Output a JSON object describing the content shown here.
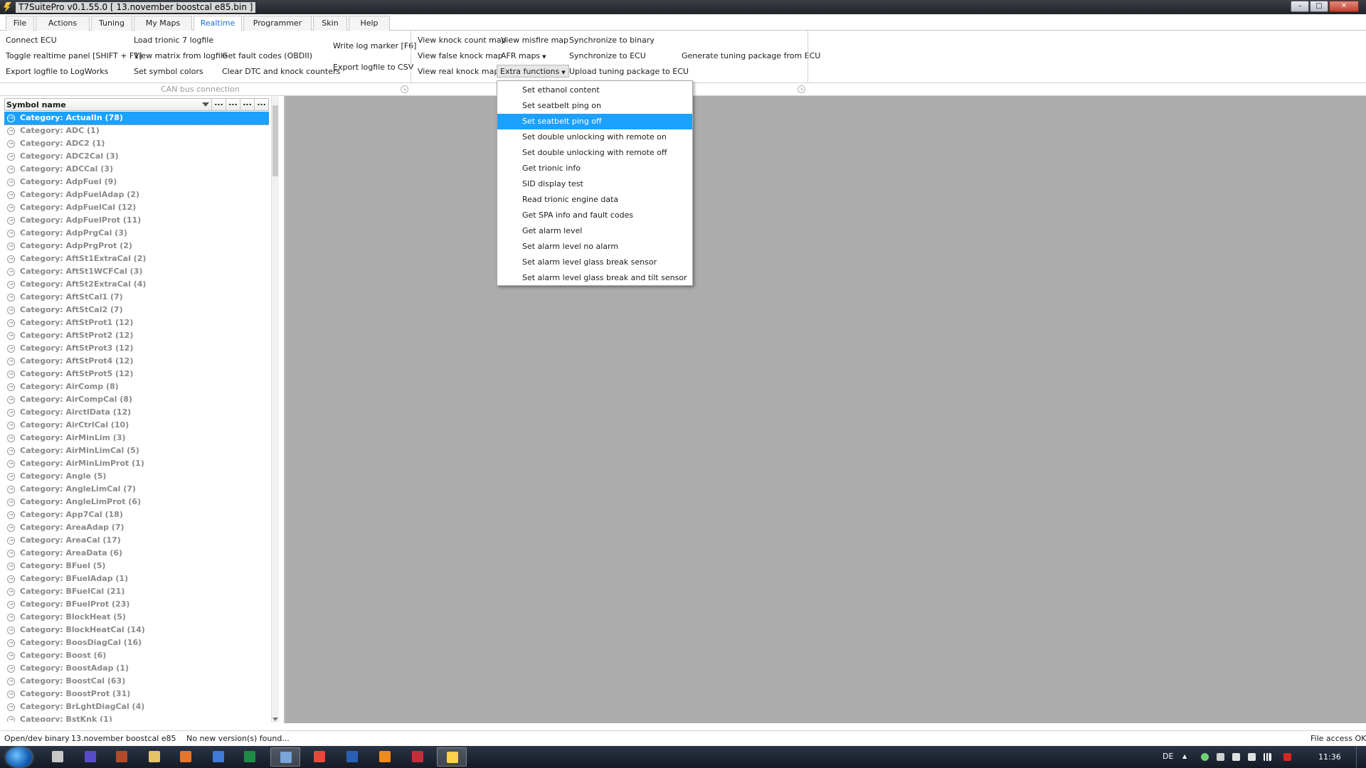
{
  "window": {
    "title": "T7SuitePro v0.1.55.0 [ 13.november boostcal e85.bin ]"
  },
  "menu": {
    "tabs": [
      {
        "label": "File"
      },
      {
        "label": "Actions"
      },
      {
        "label": "Tuning"
      },
      {
        "label": "My Maps"
      },
      {
        "label": "Realtime",
        "active": true
      },
      {
        "label": "Programmer"
      },
      {
        "label": "Skin"
      },
      {
        "label": "Help"
      }
    ]
  },
  "ribbon": {
    "can_bus": {
      "connect_ecu": "Connect ECU",
      "toggle_realtime_panel": "Toggle realtime panel [SHIFT + F1]",
      "export_logfile_logworks": "Export logfile to LogWorks",
      "load_trionic7_logfile": "Load trionic 7 logfile",
      "view_matrix_from_logfile": "View matrix from logfile",
      "set_symbol_colors": "Set symbol colors",
      "get_fault_codes": "Get fault codes (OBDII)",
      "clear_dtc": "Clear DTC and knock counters",
      "write_log_marker": "Write log marker [F6]",
      "export_logfile_csv": "Export logfile to CSV",
      "group_label": "CAN bus connection"
    },
    "maps": {
      "view_knock_count_map": "View knock count map",
      "view_false_knock_map": "View false knock map",
      "view_real_knock_map": "View real knock map",
      "view_misfire_map": "View misfire map",
      "afr_maps": "AFR maps",
      "extra_functions": "Extra functions",
      "synchronize_to_binary": "Synchronize to binary",
      "synchronize_to_ecu": "Synchronize to ECU",
      "upload_tuning_package": "Upload tuning package to ECU",
      "generate_tuning_package": "Generate tuning package from ECU"
    }
  },
  "symbol_panel": {
    "header": "Symbol name",
    "header_buttons": [
      "...",
      "...",
      "...",
      "..."
    ],
    "rows": [
      "Category: ActualIn (78)",
      "Category: ADC (1)",
      "Category: ADC2 (1)",
      "Category: ADC2Cal (3)",
      "Category: ADCCal (3)",
      "Category: AdpFuel (9)",
      "Category: AdpFuelAdap (2)",
      "Category: AdpFuelCal (12)",
      "Category: AdpFuelProt (11)",
      "Category: AdpPrgCal (3)",
      "Category: AdpPrgProt (2)",
      "Category: AftSt1ExtraCal (2)",
      "Category: AftSt1WCFCal (3)",
      "Category: AftSt2ExtraCal (4)",
      "Category: AftStCal1 (7)",
      "Category: AftStCal2 (7)",
      "Category: AftStProt1 (12)",
      "Category: AftStProt2 (12)",
      "Category: AftStProt3 (12)",
      "Category: AftStProt4 (12)",
      "Category: AftStProt5 (12)",
      "Category: AirComp (8)",
      "Category: AirCompCal (8)",
      "Category: AirctlData (12)",
      "Category: AirCtrlCal (10)",
      "Category: AirMinLim (3)",
      "Category: AirMinLimCal (5)",
      "Category: AirMinLimProt (1)",
      "Category: Angle (5)",
      "Category: AngleLimCal (7)",
      "Category: AngleLimProt (6)",
      "Category: App7Cal (18)",
      "Category: AreaAdap (7)",
      "Category: AreaCal (17)",
      "Category: AreaData (6)",
      "Category: BFuel (5)",
      "Category: BFuelAdap (1)",
      "Category: BFuelCal (21)",
      "Category: BFuelProt (23)",
      "Category: BlockHeat (5)",
      "Category: BlockHeatCal (14)",
      "Category: BoosDiagCal (16)",
      "Category: Boost (6)",
      "Category: BoostAdap (1)",
      "Category: BoostCal (63)",
      "Category: BoostProt (31)",
      "Category: BrLghtDiagCal (4)",
      "Category: BstKnk (1)"
    ],
    "selected_index": 0
  },
  "extra_functions_menu": {
    "items": [
      "Set ethanol content",
      "Set seatbelt ping on",
      "Set seatbelt ping off",
      "Set double unlocking with remote on",
      "Set double unlocking with remote off",
      "Get trionic info",
      "SID display test",
      "Read trionic engine data",
      "Get SPA info and fault codes",
      "Get alarm level",
      "Set alarm level no alarm",
      "Set alarm level glass break sensor",
      "Set alarm level glass break and tilt sensor"
    ],
    "highlighted_index": 2
  },
  "status_bar": {
    "mode": "Open/dev binary",
    "filename": "13.november boostcal e85",
    "version_msg": "No new version(s) found...",
    "file_access": "File access OK"
  },
  "taskbar": {
    "language": "DE",
    "clock": "11:36",
    "apps": [
      "windows-explorer-icon",
      "media-icon",
      "winrar-icon",
      "folder-icon",
      "firefox-icon",
      "outlook-icon",
      "excel-icon",
      "app-icon",
      "chrome-icon",
      "word-icon",
      "vlc-icon",
      "tool-icon",
      "t7suite-icon"
    ]
  },
  "colors": {
    "accent": "#1ba1ff",
    "active_tab_text": "#1a6fd0",
    "workspace": "#acacac",
    "taskbar": "#1a2230"
  }
}
